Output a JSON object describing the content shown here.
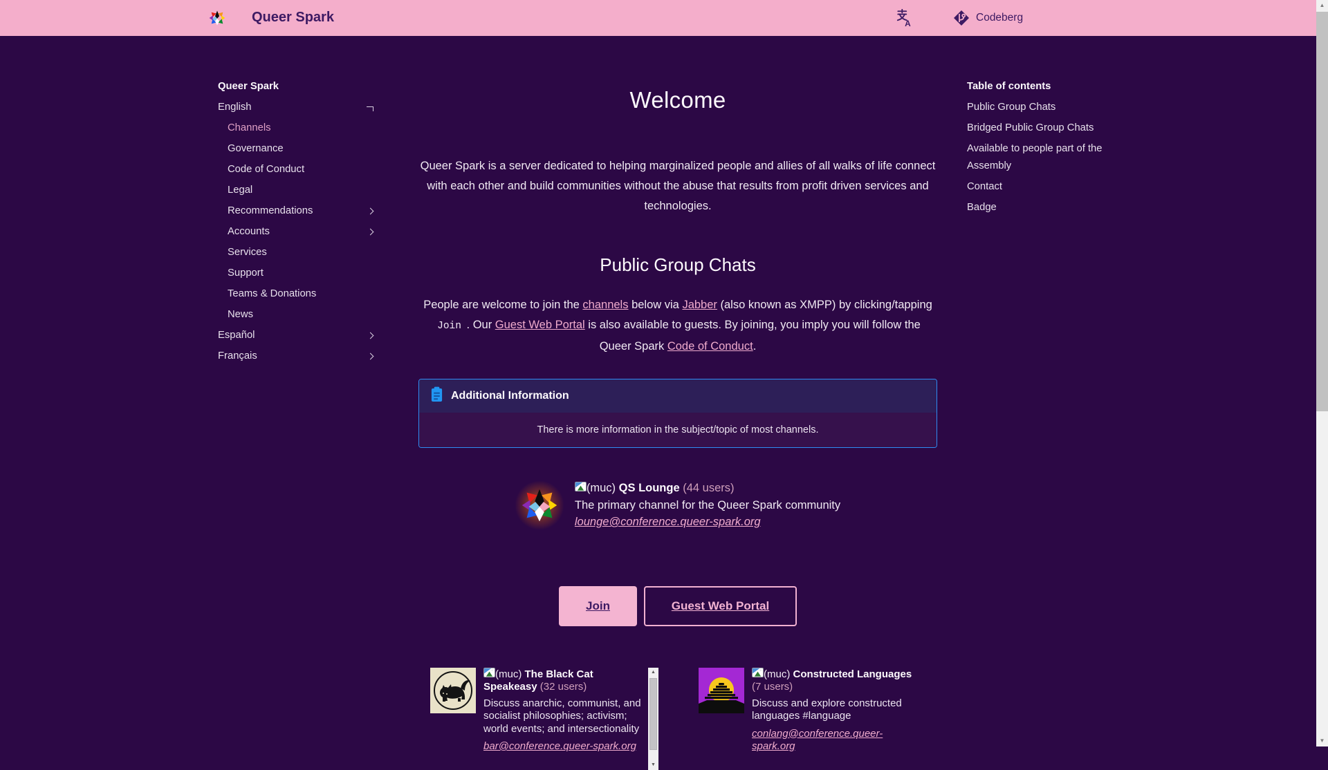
{
  "colors": {
    "navbar_pink": "#f4aecb",
    "page_background": "#2c0845",
    "link_pink": "#f0accd",
    "admonition_blue": "#2196f3",
    "navbar_text": "#3d1a63"
  },
  "navbar": {
    "title": "Queer Spark",
    "codeberg_label": "Codeberg",
    "icons": [
      "queer-spark-logo",
      "translate-icon",
      "codeberg-icon"
    ]
  },
  "sidebar": {
    "title": "Queer Spark",
    "items": [
      {
        "label": "English",
        "type": "toggle"
      },
      {
        "label": "Channels",
        "active": true
      },
      {
        "label": "Governance"
      },
      {
        "label": "Code of Conduct"
      },
      {
        "label": "Legal"
      },
      {
        "label": "Recommendations",
        "chevron": true
      },
      {
        "label": "Accounts",
        "chevron": true
      },
      {
        "label": "Services"
      },
      {
        "label": "Support"
      },
      {
        "label": "Teams & Donations"
      },
      {
        "label": "News"
      },
      {
        "label": "Español",
        "chevron": true
      },
      {
        "label": "Français",
        "chevron": true
      }
    ]
  },
  "toc": {
    "title": "Table of contents",
    "items": [
      {
        "label": "Public Group Chats"
      },
      {
        "label": "Bridged Public Group Chats"
      },
      {
        "label": "Available to people part of the Assembly"
      },
      {
        "label": "Contact"
      },
      {
        "label": "Badge"
      }
    ]
  },
  "main": {
    "welcome_title": "Welcome",
    "intro": "Queer Spark is a server dedicated to helping marginalized people and allies of all walks of life connect with each other and build communities without the abuse that results from profit driven services and technologies.",
    "section_title": "Public Group Chats",
    "join_paragraph": {
      "t1": "People are welcome to join the ",
      "l1": "channels",
      "t2": " below via ",
      "l2": "Jabber",
      "t3": " (also known as XMPP) by clicking/tapping ",
      "code": "Join",
      "t4": " . Our ",
      "l3": "Guest Web Portal",
      "t5": " is also available to guests. By joining, you imply you will follow the Queer Spark ",
      "l4": "Code of Conduct",
      "t6": "."
    },
    "admonition": {
      "title": "Additional Information",
      "body": "There is more information in the subject/topic of most channels."
    },
    "featured_channel": {
      "muc": "(muc)",
      "name": "QS Lounge",
      "users": "(44 users)",
      "description": "The primary channel for the Queer Spark community",
      "address": "lounge@conference.queer-spark.org"
    },
    "buttons": {
      "join_label": "Join",
      "guest_label": "Guest Web Portal"
    },
    "channels": [
      {
        "muc": "(muc)",
        "name": "The Black Cat Speakeasy",
        "users": "(32 users)",
        "description": "Discuss anarchic, communist, and socialist philosophies; activism; world events; and intersectionality",
        "address": "bar@conference.queer-spark.org"
      },
      {
        "muc": "(muc)",
        "name": "Constructed Languages",
        "users": "(7 users)",
        "description": "Discuss and explore constructed languages #language",
        "address": "conlang@conference.queer-spark.org"
      }
    ]
  },
  "scrollbar": {
    "up": "▲",
    "down": "▼"
  }
}
